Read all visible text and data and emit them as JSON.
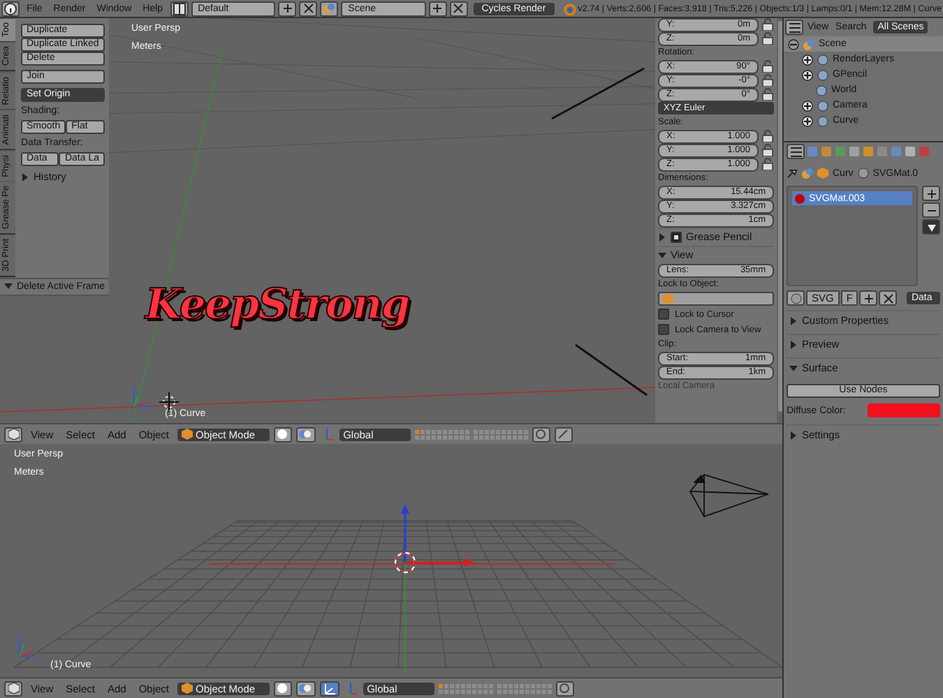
{
  "top_bar": {
    "menus": [
      "File",
      "Render",
      "Window",
      "Help"
    ],
    "screen_layout": "Default",
    "scene": "Scene",
    "render_engine": "Cycles Render",
    "stats": "v2.74 | Verts:2,606 | Faces:3,918 | Tris:5,226 | Objects:1/3 | Lamps:0/1 | Mem:12.28M | Curve"
  },
  "viewport_top": {
    "view_name": "User Persp",
    "units": "Meters",
    "object_label": "(1) Curve",
    "text_object": "KeepStrong",
    "tool_tabs": [
      {
        "label": "Too",
        "selected": true
      },
      {
        "label": "Crea",
        "selected": false
      },
      {
        "label": "Relatio",
        "selected": false
      },
      {
        "label": "Animati",
        "selected": false
      },
      {
        "label": "Physi",
        "selected": false
      },
      {
        "label": "Grease Pe",
        "selected": false
      },
      {
        "label": "3D Print",
        "selected": false
      }
    ],
    "tool_shelf": {
      "edit_buttons": [
        "Duplicate",
        "Duplicate Linked",
        "Delete"
      ],
      "join": "Join",
      "set_origin": "Set Origin",
      "shading_label": "Shading:",
      "shading_buttons": [
        "Smooth",
        "Flat"
      ],
      "data_transfer_label": "Data Transfer:",
      "data_transfer_buttons": [
        "Data",
        "Data La"
      ],
      "history": {
        "label": "History",
        "expanded": false
      }
    },
    "operator_panel": {
      "label": "Delete Active Frame",
      "expanded": true
    },
    "properties_panel": [
      {
        "kind": "field",
        "label": "Y:",
        "value": "0m",
        "lock": true
      },
      {
        "kind": "field",
        "label": "Z:",
        "value": "0m",
        "lock": true
      },
      {
        "kind": "heading",
        "label": "Rotation:"
      },
      {
        "kind": "field",
        "label": "X:",
        "value": "90°",
        "lock": true
      },
      {
        "kind": "field",
        "label": "Y:",
        "value": "-0°",
        "lock": true
      },
      {
        "kind": "field",
        "label": "Z:",
        "value": "0°",
        "lock": true
      },
      {
        "kind": "dropdown",
        "label": "XYZ Euler"
      },
      {
        "kind": "heading",
        "label": "Scale:"
      },
      {
        "kind": "field",
        "label": "X:",
        "value": "1.000",
        "lock": true
      },
      {
        "kind": "field",
        "label": "Y:",
        "value": "1.000",
        "lock": true
      },
      {
        "kind": "field",
        "label": "Z:",
        "value": "1.000",
        "lock": true
      },
      {
        "kind": "heading",
        "label": "Dimensions:"
      },
      {
        "kind": "field",
        "label": "X:",
        "value": "15.44cm",
        "lock": false
      },
      {
        "kind": "field",
        "label": "Y:",
        "value": "3.327cm",
        "lock": false
      },
      {
        "kind": "field",
        "label": "Z:",
        "value": "1cm",
        "lock": false
      },
      {
        "kind": "panel",
        "label": "Grease Pencil",
        "expanded": false,
        "checked": true
      },
      {
        "kind": "panel",
        "label": "View",
        "expanded": true
      },
      {
        "kind": "field",
        "label": "Lens:",
        "value": "35mm",
        "lock": false
      },
      {
        "kind": "heading",
        "label": "Lock to Object:"
      },
      {
        "kind": "object"
      },
      {
        "kind": "checkbox",
        "label": "Lock to Cursor",
        "checked": false
      },
      {
        "kind": "checkbox",
        "label": "Lock Camera to View",
        "checked": false
      },
      {
        "kind": "heading",
        "label": "Clip:"
      },
      {
        "kind": "field",
        "label": "Start:",
        "value": "1mm",
        "lock": false
      },
      {
        "kind": "field",
        "label": "End:",
        "value": "1km",
        "lock": false
      },
      {
        "kind": "dim",
        "label": "Local Camera"
      }
    ]
  },
  "viewport_bottom": {
    "view_name": "User Persp",
    "units": "Meters",
    "object_label": "(1) Curve"
  },
  "headers": [
    {
      "menus": [
        "View",
        "Select",
        "Add",
        "Object"
      ],
      "mode": "Object Mode",
      "orientation": "Global",
      "manipulator": false
    },
    {
      "menus": [
        "View",
        "Select",
        "Add",
        "Object"
      ],
      "mode": "Object Mode",
      "orientation": "Global",
      "manipulator": true
    }
  ],
  "outliner": {
    "menus": [
      "View",
      "Search"
    ],
    "filter": "All Scenes",
    "tree": [
      {
        "label": "Scene",
        "expanded": true,
        "children": [
          {
            "label": "RenderLayers",
            "expanded": false
          },
          {
            "label": "GPencil",
            "expanded": false
          },
          {
            "label": "World"
          },
          {
            "label": "Camera",
            "expanded": false
          },
          {
            "label": "Curve",
            "expanded": false
          }
        ]
      }
    ]
  },
  "properties": {
    "breadcrumb": [
      "Curv",
      "SVGMat.0"
    ],
    "materials": [
      {
        "name": "SVGMat.003",
        "selected": true,
        "color": "#c00010"
      }
    ],
    "slot_name": "SVG",
    "fake_user": "F",
    "link": "Data",
    "panels": [
      {
        "label": "Custom Properties",
        "expanded": false
      },
      {
        "label": "Preview",
        "expanded": false
      },
      {
        "label": "Surface",
        "expanded": true,
        "use_nodes": "Use Nodes",
        "diffuse_label": "Diffuse Color:"
      },
      {
        "label": "Settings",
        "expanded": false
      }
    ]
  }
}
